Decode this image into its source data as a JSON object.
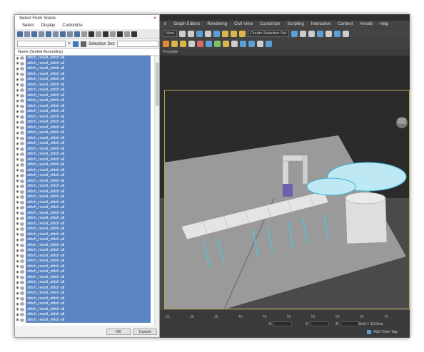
{
  "dialog": {
    "title": "Select From Scene",
    "close_glyph": "×",
    "menu": [
      "Select",
      "Display",
      "Customize"
    ],
    "search_clear_glyph": "×",
    "selection_set_label": "Selection Set:",
    "column_header": "Name (Sorted Ascending)",
    "item_label": "stitch_result_stitch all",
    "ok_label": "OK",
    "cancel_label": "Cancel"
  },
  "max": {
    "menu": [
      "n",
      "Graph Editors",
      "Rendering",
      "Civil View",
      "Customize",
      "Scripting",
      "Interactive",
      "Content",
      "Arnold",
      "Help"
    ],
    "view_select": "View",
    "create_selection_set": "Create Selection Set",
    "ribbon_tab": "Populate",
    "timeline_ticks": [
      "25",
      "30",
      "35",
      "40",
      "45",
      "50",
      "55",
      "60",
      "65",
      "70"
    ],
    "coord_x": "X:",
    "coord_y": "Y:",
    "coord_z": "Z:",
    "grid": "Grid = 10.0cm",
    "add_time_tag": "Add Time Tag"
  }
}
